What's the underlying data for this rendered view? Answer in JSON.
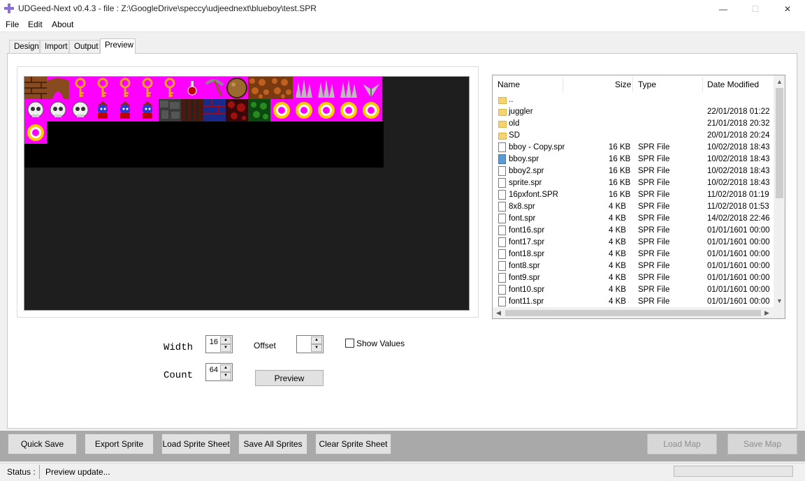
{
  "window": {
    "title": "UDGeed-Next v0.4.3 - file : Z:\\GoogleDrive\\speccy\\udjeednext\\blueboy\\test.SPR",
    "controls": {
      "minimize": "—",
      "maximize": "☐",
      "close": "✕"
    }
  },
  "menu": {
    "file": "File",
    "edit": "Edit",
    "about": "About"
  },
  "tabs": {
    "design": "Design",
    "import": "Import",
    "output": "Output",
    "preview": "Preview",
    "active": "Preview"
  },
  "colors": {
    "sheet_bg": "#ff00ff",
    "canvas_bg": "#1e1e1e",
    "toolbar_bg": "#a9a9a9"
  },
  "file_browser": {
    "columns": {
      "name": "Name",
      "size": "Size",
      "type": "Type",
      "date": "Date Modified"
    },
    "rows": [
      {
        "name": "..",
        "size": "",
        "type": "",
        "date": "",
        "icon": "folder"
      },
      {
        "name": "juggler",
        "size": "",
        "type": "",
        "date": "22/01/2018 01:22",
        "icon": "folder"
      },
      {
        "name": "old",
        "size": "",
        "type": "",
        "date": "21/01/2018 20:32",
        "icon": "folder"
      },
      {
        "name": "SD",
        "size": "",
        "type": "",
        "date": "20/01/2018 20:24",
        "icon": "folder"
      },
      {
        "name": "bboy - Copy.spr",
        "size": "16 KB",
        "type": "SPR File",
        "date": "10/02/2018 18:43",
        "icon": "doc"
      },
      {
        "name": "bboy.spr",
        "size": "16 KB",
        "type": "SPR File",
        "date": "10/02/2018 18:43",
        "icon": "doc-blue"
      },
      {
        "name": "bboy2.spr",
        "size": "16 KB",
        "type": "SPR File",
        "date": "10/02/2018 18:43",
        "icon": "doc"
      },
      {
        "name": "sprite.spr",
        "size": "16 KB",
        "type": "SPR File",
        "date": "10/02/2018 18:43",
        "icon": "doc"
      },
      {
        "name": "16pxfont.SPR",
        "size": "16 KB",
        "type": "SPR File",
        "date": "11/02/2018 01:19",
        "icon": "doc"
      },
      {
        "name": "8x8.spr",
        "size": "4 KB",
        "type": "SPR File",
        "date": "11/02/2018 01:53",
        "icon": "doc"
      },
      {
        "name": "font.spr",
        "size": "4 KB",
        "type": "SPR File",
        "date": "14/02/2018 22:46",
        "icon": "doc"
      },
      {
        "name": "font16.spr",
        "size": "4 KB",
        "type": "SPR File",
        "date": "01/01/1601 00:00",
        "icon": "doc"
      },
      {
        "name": "font17.spr",
        "size": "4 KB",
        "type": "SPR File",
        "date": "01/01/1601 00:00",
        "icon": "doc"
      },
      {
        "name": "font18.spr",
        "size": "4 KB",
        "type": "SPR File",
        "date": "01/01/1601 00:00",
        "icon": "doc"
      },
      {
        "name": "font8.spr",
        "size": "4 KB",
        "type": "SPR File",
        "date": "01/01/1601 00:00",
        "icon": "doc"
      },
      {
        "name": "font9.spr",
        "size": "4 KB",
        "type": "SPR File",
        "date": "01/01/1601 00:00",
        "icon": "doc"
      },
      {
        "name": "font10.spr",
        "size": "4 KB",
        "type": "SPR File",
        "date": "01/01/1601 00:00",
        "icon": "doc"
      },
      {
        "name": "font11.spr",
        "size": "4 KB",
        "type": "SPR File",
        "date": "01/01/1601 00:00",
        "icon": "doc"
      }
    ]
  },
  "controls": {
    "width_label": "Width",
    "width_value": "16",
    "offset_label": "Offset",
    "offset_value": "",
    "count_label": "Count",
    "count_value": "64",
    "show_values_label": "Show Values",
    "show_values_checked": false,
    "preview_button": "Preview",
    "spin_up": "▲",
    "spin_down": "▼"
  },
  "toolbar": {
    "quick_save": "Quick Save",
    "export_sprite": "Export Sprite",
    "load_sprite_sheet": "Load Sprite Sheet",
    "save_all_sprites": "Save All Sprites",
    "clear_sprite_sheet": "Clear Sprite Sheet",
    "load_map": "Load Map",
    "save_map": "Save Map"
  },
  "status": {
    "label": "Status :",
    "message": "Preview update..."
  },
  "sprite_sheet": {
    "tiles": [
      "brick",
      "arch",
      "key",
      "key",
      "key",
      "key",
      "key",
      "potion",
      "pickaxe",
      "boulder",
      "rocks",
      "rocks",
      "spikes",
      "spikes",
      "spikes",
      "plant",
      "skull",
      "skull",
      "skull",
      "boy",
      "boy",
      "boy",
      "stone",
      "wood",
      "blue-brick",
      "red-rock",
      "grass",
      "ring",
      "ring",
      "ring",
      "ring",
      "ring",
      "ring"
    ]
  }
}
